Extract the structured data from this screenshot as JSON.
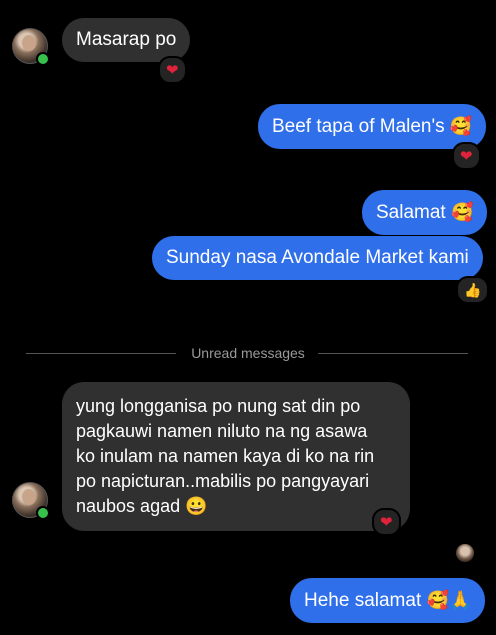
{
  "messages": {
    "m1": "Masarap po",
    "m2": "Beef tapa of Malen's",
    "m3": "Salamat",
    "m4": "Sunday nasa Avondale Market kami",
    "m5_line1": "yung longganisa po nung sat din po",
    "m5_line2": "pagkauwi namen niluto na ng asawa",
    "m5_line3": "ko inulam na namen kaya di ko na rin",
    "m5_line4": "po napicturan..mabilis po pangyayari",
    "m5_line5": "naubos agad",
    "m6": "Hehe salamat"
  },
  "emojis": {
    "smiling_hearts": "🥰",
    "grin": "😀",
    "folded_hands": "🙏",
    "heart": "❤",
    "thumbs_up": "👍"
  },
  "divider": {
    "label": "Unread messages"
  },
  "colors": {
    "background": "#000000",
    "incoming_bubble": "#303030",
    "outgoing_bubble": "#2f6fea",
    "heart": "#e0223a",
    "online": "#37c04b"
  },
  "icons": [
    "avatar",
    "online-dot",
    "heart-reaction",
    "thumbs-up-reaction",
    "seen-avatar"
  ]
}
